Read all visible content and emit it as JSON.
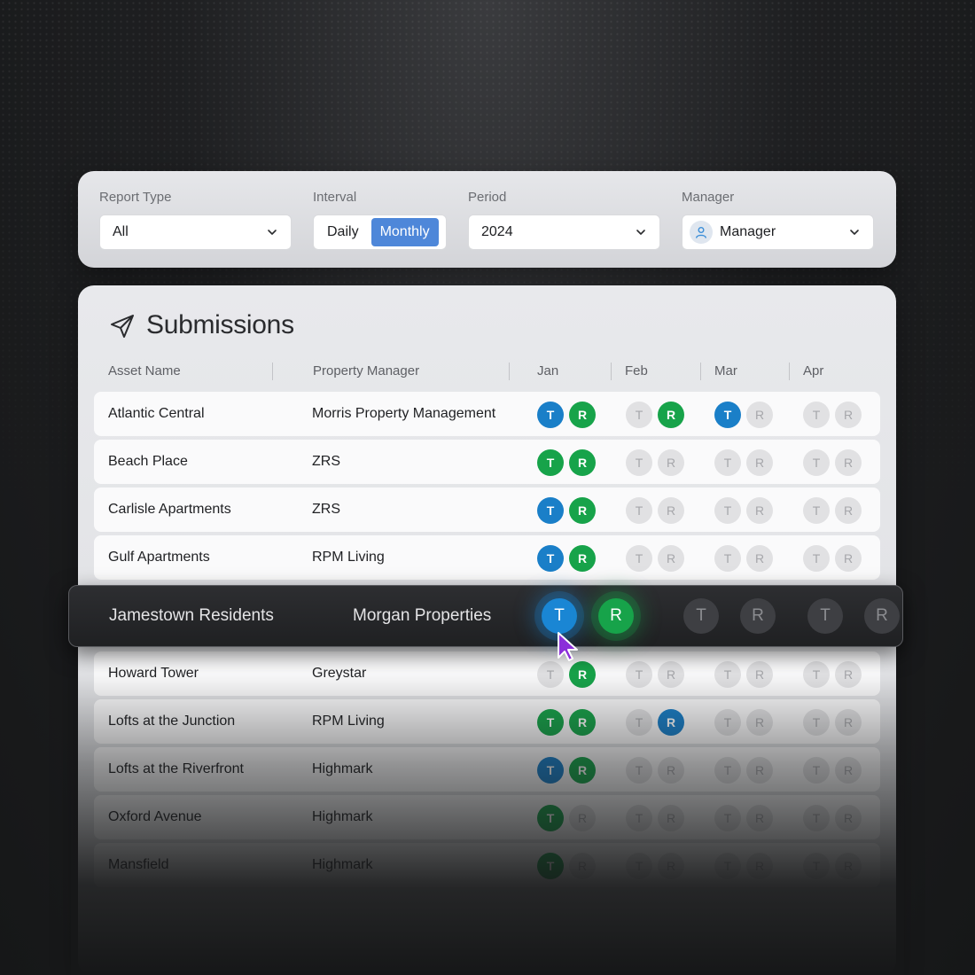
{
  "filters": {
    "report_type": {
      "label": "Report Type",
      "value": "All"
    },
    "interval": {
      "label": "Interval",
      "options": [
        "Daily",
        "Monthly"
      ],
      "selected": "Monthly"
    },
    "period": {
      "label": "Period",
      "value": "2024"
    },
    "manager": {
      "label": "Manager",
      "value": "Manager"
    }
  },
  "submissions": {
    "title": "Submissions",
    "columns": [
      "Asset Name",
      "Property Manager",
      "Jan",
      "Feb",
      "Mar",
      "Apr"
    ],
    "rows": [
      {
        "asset": "Atlantic Central",
        "manager": "Morris Property Management",
        "months": [
          [
            "blue",
            "green"
          ],
          [
            "grey",
            "green"
          ],
          [
            "blue",
            "grey"
          ],
          [
            "grey",
            "grey"
          ]
        ]
      },
      {
        "asset": "Beach Place",
        "manager": "ZRS",
        "months": [
          [
            "green",
            "green"
          ],
          [
            "grey",
            "grey"
          ],
          [
            "grey",
            "grey"
          ],
          [
            "grey",
            "grey"
          ]
        ]
      },
      {
        "asset": "Carlisle Apartments",
        "manager": "ZRS",
        "months": [
          [
            "blue",
            "green"
          ],
          [
            "grey",
            "grey"
          ],
          [
            "grey",
            "grey"
          ],
          [
            "grey",
            "grey"
          ]
        ]
      },
      {
        "asset": "Gulf Apartments",
        "manager": "RPM Living",
        "months": [
          [
            "blue",
            "green"
          ],
          [
            "grey",
            "grey"
          ],
          [
            "grey",
            "grey"
          ],
          [
            "grey",
            "grey"
          ]
        ]
      },
      {
        "asset": "Howard Tower",
        "manager": "Greystar",
        "months": [
          [
            "grey",
            "green"
          ],
          [
            "grey",
            "grey"
          ],
          [
            "grey",
            "grey"
          ],
          [
            "grey",
            "grey"
          ]
        ]
      },
      {
        "asset": "Lofts at the Junction",
        "manager": "RPM Living",
        "months": [
          [
            "green",
            "green"
          ],
          [
            "grey",
            "blue"
          ],
          [
            "grey",
            "grey"
          ],
          [
            "grey",
            "grey"
          ]
        ]
      },
      {
        "asset": "Lofts at the Riverfront",
        "manager": "Highmark",
        "months": [
          [
            "blue",
            "green"
          ],
          [
            "grey",
            "grey"
          ],
          [
            "grey",
            "grey"
          ],
          [
            "grey",
            "grey"
          ]
        ]
      },
      {
        "asset": "Oxford Avenue",
        "manager": "Highmark",
        "months": [
          [
            "green",
            "grey"
          ],
          [
            "grey",
            "grey"
          ],
          [
            "grey",
            "grey"
          ],
          [
            "grey",
            "grey"
          ]
        ]
      },
      {
        "asset": "Mansfield",
        "manager": "Highmark",
        "months": [
          [
            "green",
            "grey"
          ],
          [
            "grey",
            "grey"
          ],
          [
            "grey",
            "grey"
          ],
          [
            "grey",
            "grey"
          ]
        ]
      }
    ],
    "highlighted": {
      "asset": "Jamestown Residents",
      "manager": "Morgan Properties",
      "months": [
        [
          "blue",
          "green"
        ],
        [
          "grey",
          "grey"
        ],
        [
          "grey",
          "grey"
        ]
      ]
    },
    "badge_letters": [
      "T",
      "R"
    ]
  },
  "colors": {
    "blue": "#1a7fc8",
    "green": "#17a34a",
    "grey": "#e1e1e3",
    "active_tab": "#4e87d9"
  }
}
